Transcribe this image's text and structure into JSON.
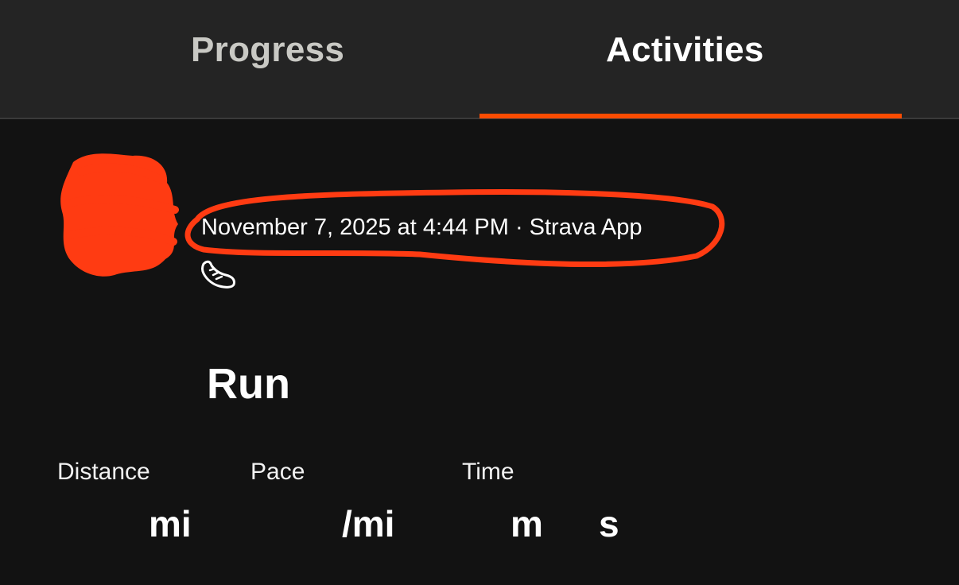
{
  "tabs": [
    {
      "label": "Progress",
      "active": false
    },
    {
      "label": "Activities",
      "active": true
    }
  ],
  "activity": {
    "meta": "November 7, 2025 at 4:44 PM · Strava App",
    "sport_icon": "running-shoe-icon",
    "title": "Run"
  },
  "stats": {
    "distance": {
      "label": "Distance",
      "unit": "mi"
    },
    "pace": {
      "label": "Pace",
      "unit": "/mi"
    },
    "time": {
      "label": "Time",
      "minutes_unit": "m",
      "seconds_unit": "s"
    }
  },
  "colors": {
    "accent": "#fc4c02",
    "annotation": "#ff3b12",
    "background": "#121212",
    "tab_bar": "#242424",
    "inactive_tab": "#c9c9c4"
  }
}
